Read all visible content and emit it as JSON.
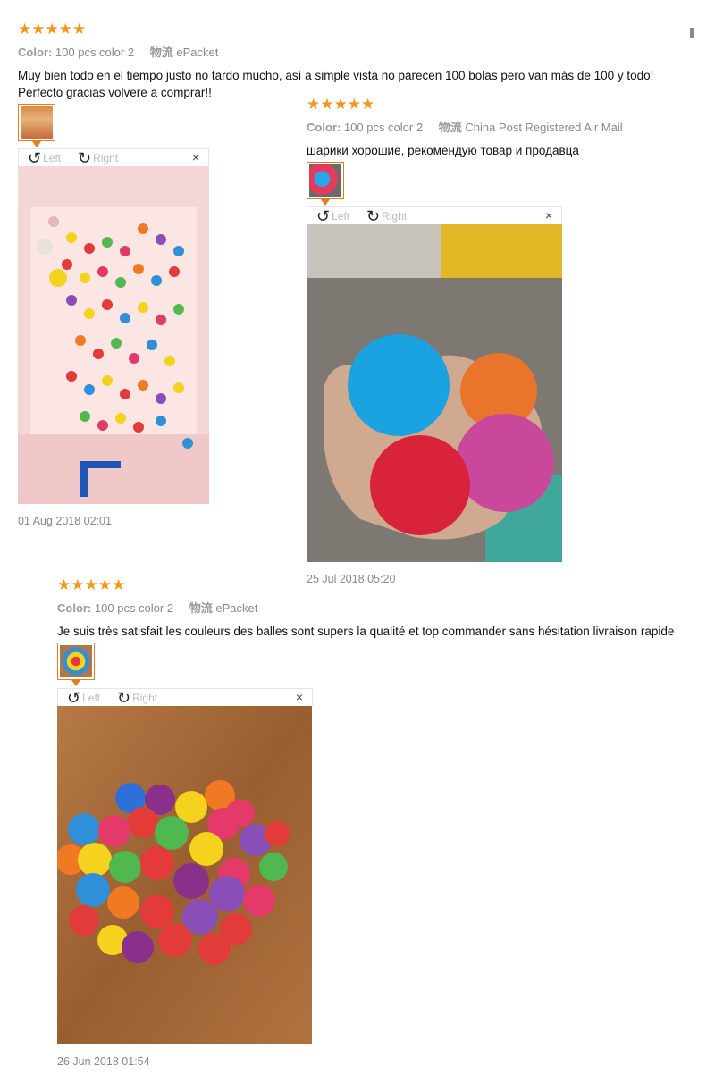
{
  "reviews": [
    {
      "stars": "★★★★★",
      "color_label": "Color:",
      "color_value": "100 pcs color 2",
      "ship_label": "物流",
      "ship_value": "ePacket",
      "text": "Muy bien todo en el tiempo justo no tardo mucho, así a simple vista no parecen 100 bolas pero van más de 100 y todo! Perfecto gracias volvere a comprar!!",
      "rotate_left": "Left",
      "rotate_right": "Right",
      "close": "×",
      "date": "01 Aug 2018 02:01"
    },
    {
      "stars": "★★★★★",
      "color_label": "Color:",
      "color_value": "100 pcs color 2",
      "ship_label": "物流",
      "ship_value": "China Post Registered Air Mail",
      "text": "шарики хорошие, рекомендую товар и продавца",
      "rotate_left": "Left",
      "rotate_right": "Right",
      "close": "×",
      "date": "25 Jul 2018 05:20"
    },
    {
      "stars": "★★★★★",
      "color_label": "Color:",
      "color_value": "100 pcs color 2",
      "ship_label": "物流",
      "ship_value": "ePacket",
      "text": "Je suis très satisfait les couleurs des balles sont supers la qualité et top commander sans hésitation livraison rapide",
      "rotate_left": "Left",
      "rotate_right": "Right",
      "close": "×",
      "date": "26 Jun 2018 01:54"
    }
  ],
  "icons": {
    "rotate_left": "rotate-left-icon",
    "rotate_right": "rotate-right-icon",
    "close": "close-icon",
    "star": "star-icon"
  },
  "colors": {
    "star": "#f5951d",
    "accent_border": "#e77c1b",
    "meta_text": "#888888"
  }
}
